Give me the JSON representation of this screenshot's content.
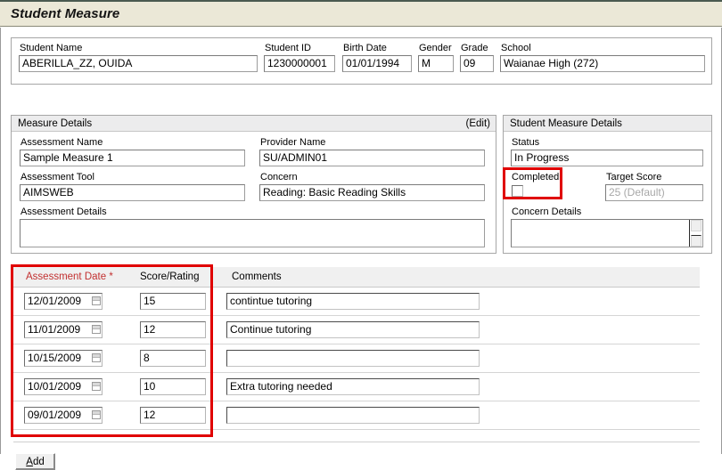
{
  "window": {
    "title": "Student Measure"
  },
  "student_header": {
    "fields": [
      {
        "label": "Student Name",
        "value": "ABERILLA_ZZ, OUIDA"
      },
      {
        "label": "Student ID",
        "value": "1230000001"
      },
      {
        "label": "Birth Date",
        "value": "01/01/1994"
      },
      {
        "label": "Gender",
        "value": "M"
      },
      {
        "label": "Grade",
        "value": "09"
      },
      {
        "label": "School",
        "value": "Waianae High (272)"
      }
    ]
  },
  "measure_details": {
    "title": "Measure Details",
    "edit_link": "(Edit)",
    "assessment_name_label": "Assessment Name",
    "assessment_name_value": "Sample Measure 1",
    "provider_name_label": "Provider Name",
    "provider_name_value": "SU/ADMIN01",
    "assessment_tool_label": "Assessment Tool",
    "assessment_tool_value": "AIMSWEB",
    "concern_label": "Concern",
    "concern_value": "Reading: Basic Reading Skills",
    "assessment_details_label": "Assessment Details",
    "assessment_details_value": ""
  },
  "student_measure_details": {
    "title": "Student Measure Details",
    "status_label": "Status",
    "status_value": "In Progress",
    "completed_label": "Completed",
    "completed_checked": false,
    "target_score_label": "Target Score",
    "target_score_value": "25 (Default)",
    "concern_details_label": "Concern Details",
    "concern_details_value": ""
  },
  "grid": {
    "columns": {
      "date": "Assessment Date *",
      "score": "Score/Rating",
      "comments": "Comments"
    },
    "rows": [
      {
        "date": "12/01/2009",
        "score": "15",
        "comment": "contintue tutoring"
      },
      {
        "date": "11/01/2009",
        "score": "12",
        "comment": "Continue tutoring"
      },
      {
        "date": "10/15/2009",
        "score": "8",
        "comment": ""
      },
      {
        "date": "10/01/2009",
        "score": "10",
        "comment": "Extra tutoring needed"
      },
      {
        "date": "09/01/2009",
        "score": "12",
        "comment": ""
      }
    ]
  },
  "footer": {
    "add_button_accesskey": "A",
    "add_button_rest": "dd"
  },
  "colors": {
    "title_bar_bg": "#ebe8d7",
    "annotation_red": "#e00000",
    "required_label_red": "#c23030",
    "panel_header_bg": "#ececed",
    "disabled_text": "#a8a8a8"
  }
}
